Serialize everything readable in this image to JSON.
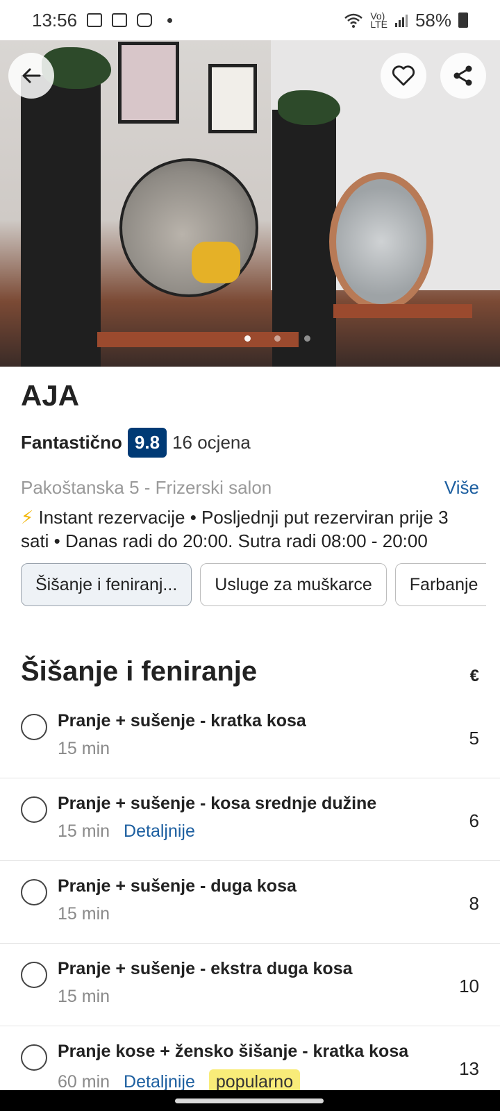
{
  "status_bar": {
    "time": "13:56",
    "battery": "58%",
    "icons": [
      "gallery-icon",
      "calendar-icon",
      "bag-icon",
      "wifi-icon",
      "volte-icon",
      "signal-icon",
      "battery-icon"
    ],
    "volte_label": "Vo)\nLTE"
  },
  "hero": {
    "image_count": 3,
    "active_image": 1
  },
  "salon": {
    "name": "AJA",
    "rating_label": "Fantastično",
    "rating_score": "9.8",
    "review_count": "16 ocjena",
    "address": "Pakoštanska 5 - Frizerski salon",
    "more_label": "Više",
    "description_bolt": "⚡",
    "description": " Instant rezervacije • Posljednji put rezerviran prije 3 sati • Danas radi do 20:00. Sutra radi 08:00 - 20:00"
  },
  "categories": [
    {
      "label": "Šišanje i feniranj...",
      "active": true
    },
    {
      "label": "Usluge za muškarce",
      "active": false
    },
    {
      "label": "Farbanje",
      "active": false
    }
  ],
  "section": {
    "title": "Šišanje i feniranje",
    "currency": "€"
  },
  "services": [
    {
      "name": "Pranje + sušenje - kratka kosa",
      "duration": "15 min",
      "detail": "",
      "badge": "",
      "price": "5"
    },
    {
      "name": "Pranje + sušenje - kosa srednje dužine",
      "duration": "15 min",
      "detail": "Detaljnije",
      "badge": "",
      "price": "6"
    },
    {
      "name": "Pranje + sušenje - duga kosa",
      "duration": "15 min",
      "detail": "",
      "badge": "",
      "price": "8"
    },
    {
      "name": "Pranje + sušenje - ekstra duga kosa",
      "duration": "15 min",
      "detail": "",
      "badge": "",
      "price": "10"
    },
    {
      "name": "Pranje kose + žensko šišanje - kratka kosa",
      "duration": "60 min",
      "detail": "Detaljnije",
      "badge": "popularno",
      "price": "13"
    }
  ],
  "colors": {
    "brand_blue": "#003a75",
    "link_blue": "#1d5fa0",
    "badge_yellow": "#f8ec79"
  }
}
